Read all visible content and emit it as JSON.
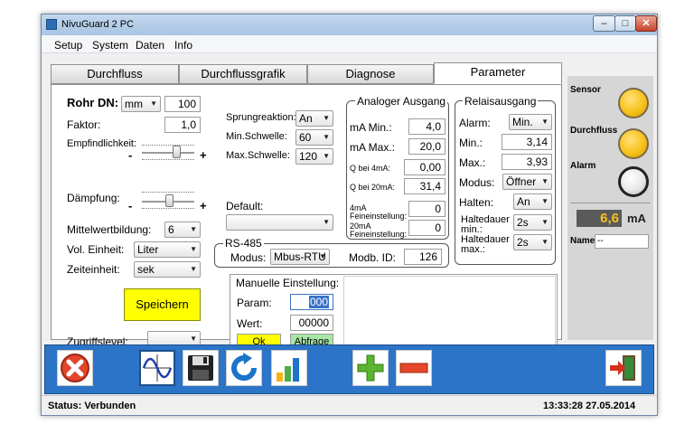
{
  "window": {
    "title": "NivuGuard 2 PC",
    "minimize": "–",
    "maximize": "□",
    "close": "✕"
  },
  "menu": [
    "Setup",
    "System",
    "Daten",
    "Info"
  ],
  "tabs": [
    "Durchfluss",
    "Durchflussgrafik",
    "Diagnose",
    "Parameter"
  ],
  "left": {
    "rohr_label": "Rohr DN:",
    "rohr_unit": "mm",
    "rohr_value": "100",
    "faktor_label": "Faktor:",
    "faktor_value": "1,0",
    "empf_label": "Empfindlichkeit:",
    "daempf_label": "Dämpfung:",
    "minus": "-",
    "plus": "+",
    "mittel_label": "Mittelwertbildung:",
    "mittel_value": "6",
    "vol_label": "Vol. Einheit:",
    "vol_value": "Liter",
    "zeit_label": "Zeiteinheit:",
    "zeit_value": "sek",
    "save": "Speichern",
    "zugriff_label": "Zugriffslevel:",
    "zugriff_value": ""
  },
  "middle": {
    "sprung_label": "Sprungreaktion:",
    "sprung_value": "An",
    "min_label": "Min.Schwelle:",
    "min_value": "60",
    "max_label": "Max.Schwelle:",
    "max_value": "120",
    "default_label": "Default:",
    "default_value": ""
  },
  "analog": {
    "title": "Analoger Ausgang",
    "ma_min_label": "mA Min.:",
    "ma_min": "4,0",
    "ma_max_label": "mA Max.:",
    "ma_max": "20,0",
    "q4_label": "Q bei 4mA:",
    "q4": "0,00",
    "q20_label": "Q bei 20mA:",
    "q20": "31,4",
    "fein4_label1": "4mA",
    "fein4_label2": "Feineinstellung:",
    "fein4": "0",
    "fein20_label1": "20mA",
    "fein20_label2": "Feineinstellung:",
    "fein20": "0"
  },
  "relais": {
    "title": "Relaisausgang",
    "alarm_label": "Alarm:",
    "alarm_value": "Min.",
    "min_label": "Min.:",
    "min": "3,14",
    "max_label": "Max.:",
    "max": "3,93",
    "modus_label": "Modus:",
    "modus_value": "Öffner",
    "halten_label": "Halten:",
    "halten_value": "An",
    "hmin_label1": "Haltedauer",
    "hmin_label2": "min.:",
    "hmin_value": "2s",
    "hmax_label1": "Haltedauer",
    "hmax_label2": "max.:",
    "hmax_value": "2s"
  },
  "rs485": {
    "title": "RS-485",
    "modus_label": "Modus:",
    "modus_value": "Mbus-RTU",
    "id_label": "Modb. ID:",
    "id_value": "126"
  },
  "manual": {
    "title": "Manuelle Einstellung:",
    "param_label": "Param:",
    "param_value": "000",
    "wert_label": "Wert:",
    "wert_value": "00000",
    "ok": "Ok",
    "abfrage": "Abfrage"
  },
  "side": {
    "sensor": "Sensor",
    "durchfluss": "Durchfluss",
    "alarm": "Alarm",
    "value": "6,6",
    "unit": "mA",
    "name_label": "Name",
    "name_value": "--"
  },
  "colors": {
    "bulb_on": "#f7c21a",
    "bulb_off": "#e8e8e8",
    "toolbar": "#2b74c8",
    "save": "#ffff00",
    "value_box": "#5a5a5a"
  },
  "toolbar_icons": [
    "cancel-icon",
    "wave-icon",
    "save-icon",
    "refresh-icon",
    "bar-chart-icon",
    "plus-icon",
    "minus-icon",
    "exit-icon"
  ],
  "status": {
    "text": "Status: Verbunden",
    "datetime": "13:33:28 27.05.2014"
  }
}
